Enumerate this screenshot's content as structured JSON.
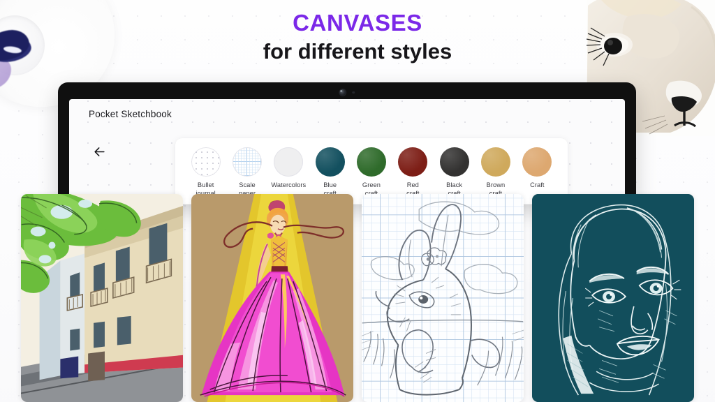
{
  "headline": {
    "line1": "CANVASES",
    "line2": "for different styles",
    "accent_color": "#7b28e8",
    "text_color": "#17161a"
  },
  "device": {
    "type": "tablet",
    "bezel_color": "#101010",
    "camera": "front-camera"
  },
  "app": {
    "title": "Pocket Sketchbook",
    "back_label": "←"
  },
  "picker": {
    "card_label": "canvas-type-picker",
    "items": [
      {
        "label": "Bullet\njournal",
        "texture": "dots",
        "color": "#ffffff"
      },
      {
        "label": "Scale\npaper",
        "texture": "grid",
        "color": "#ffffff"
      },
      {
        "label": "Watercolors",
        "texture": "plain",
        "color": "#efeff0"
      },
      {
        "label": "Blue\ncraft",
        "texture": "solid",
        "color": "#13505f"
      },
      {
        "label": "Green\ncraft",
        "texture": "solid",
        "color": "#2f6b2b"
      },
      {
        "label": "Red\ncraft",
        "texture": "solid",
        "color": "#7d1e16"
      },
      {
        "label": "Black\ncraft",
        "texture": "solid",
        "color": "#333231"
      },
      {
        "label": "Brown\ncraft",
        "texture": "solid",
        "color": "#cfa95c"
      },
      {
        "label": "Craft",
        "texture": "solid",
        "color": "#dda870"
      }
    ]
  },
  "gallery": {
    "items": [
      {
        "name": "street-scene-drawing",
        "description": "Street with green tree foliage and beige balconied buildings"
      },
      {
        "name": "fashion-sketch-drawing",
        "description": "Fashion illustration of magenta gown under yellow spotlight on craft paper"
      },
      {
        "name": "rabbit-sketch-drawing",
        "description": "Pencil rabbit sketch on blue graph paper with clouds and grass"
      },
      {
        "name": "portrait-drawing",
        "description": "White line portrait of a woman on dark teal craft paper"
      }
    ]
  },
  "decorations": {
    "palette": "paint-palette-photo",
    "lion": "lion-watercolor-photo",
    "background": "dotted-paper"
  }
}
